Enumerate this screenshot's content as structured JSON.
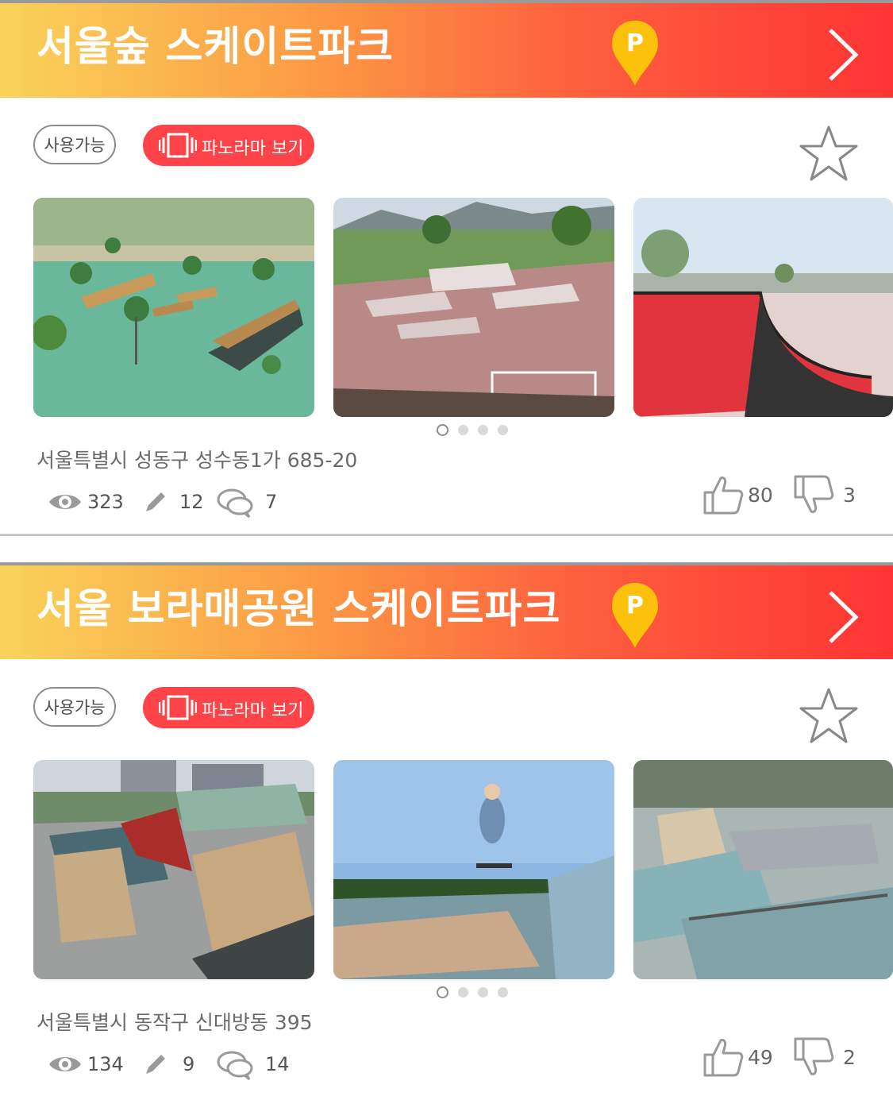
{
  "colors": {
    "header_start": "#f9d35a",
    "header_end": "#ff3434",
    "accent_red": "#fe4349",
    "pin_yellow": "#fbc10b"
  },
  "parks": [
    {
      "title": "서울숲 스케이트파크",
      "parking_label": "P",
      "status_badge": "사용가능",
      "panorama_label": "파노라마 보기",
      "address": "서울특별시 성동구 성수동1가 685-20",
      "views": "323",
      "edits": "12",
      "comments": "7",
      "likes": "80",
      "dislikes": "3",
      "photo_count": 4,
      "active_photo": 1
    },
    {
      "title": "서울 보라매공원 스케이트파크",
      "parking_label": "P",
      "status_badge": "사용가능",
      "panorama_label": "파노라마 보기",
      "address": "서울특별시 동작구 신대방동 395",
      "views": "134",
      "edits": "9",
      "comments": "14",
      "likes": "49",
      "dislikes": "2",
      "photo_count": 4,
      "active_photo": 1
    }
  ]
}
